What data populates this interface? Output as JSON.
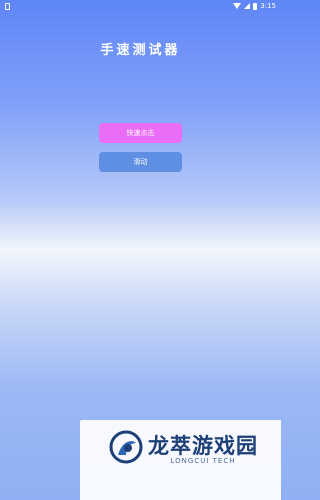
{
  "status_bar": {
    "time": "3:15",
    "icons": [
      "sim-icon",
      "wifi-icon",
      "signal-icon",
      "battery-icon"
    ]
  },
  "title": "手速测试器",
  "buttons": {
    "quick_tap": "快速点击",
    "swipe": "滑动"
  },
  "colors": {
    "quick_tap_bg": "#ea6ef5",
    "swipe_bg": "#5f8fe3",
    "gradient_top": "#5f86f7",
    "gradient_mid": "#f2f6fb",
    "gradient_bottom": "#8fb0f4"
  },
  "watermark": {
    "name": "龙萃游戏园",
    "subtitle": "LONGCUI TECH"
  }
}
